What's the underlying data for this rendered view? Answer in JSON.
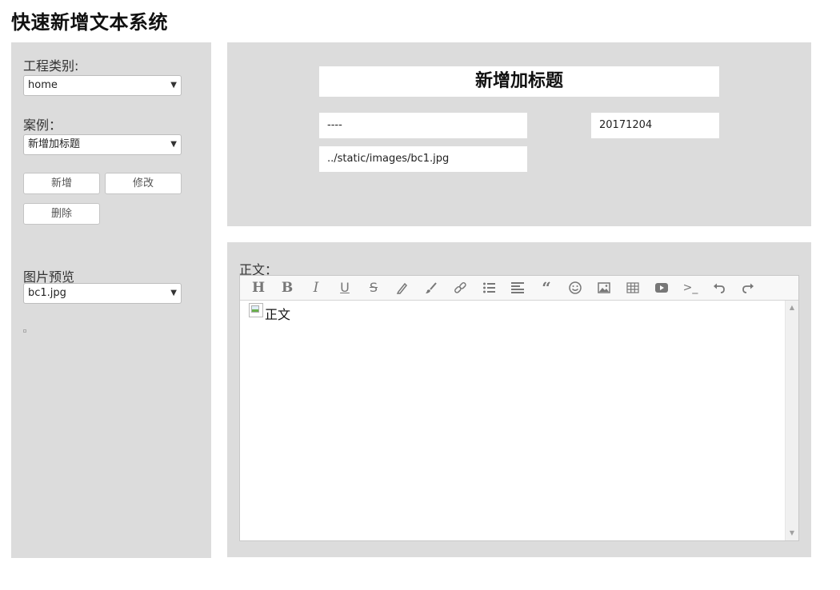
{
  "app": {
    "title": "快速新增文本系统"
  },
  "sidebar": {
    "project_type_label": "工程类别:",
    "project_type_value": "home",
    "case_label": "案例：",
    "case_value": "新增加标题",
    "buttons": {
      "add": "新增",
      "edit": "修改",
      "delete": "删除"
    },
    "image_preview_label": "图片预览",
    "image_preview_value": "bc1.jpg"
  },
  "meta": {
    "title_value": "新增加标题",
    "subtitle_value": "----",
    "date_value": "20171204",
    "image_path_value": "../static/images/bc1.jpg"
  },
  "editor": {
    "label": "正文：",
    "toolbar": [
      "heading-icon",
      "bold-icon",
      "italic-icon",
      "underline-icon",
      "strikethrough-icon",
      "pen-icon",
      "brush-icon",
      "link-icon",
      "list-icon",
      "align-left-icon",
      "quote-icon",
      "emoji-icon",
      "image-icon",
      "table-icon",
      "video-icon",
      "code-icon",
      "undo-icon",
      "redo-icon"
    ],
    "content_alt": "正文"
  },
  "colors": {
    "panel_bg": "#dcdcdc",
    "icon_gray": "#777777"
  }
}
